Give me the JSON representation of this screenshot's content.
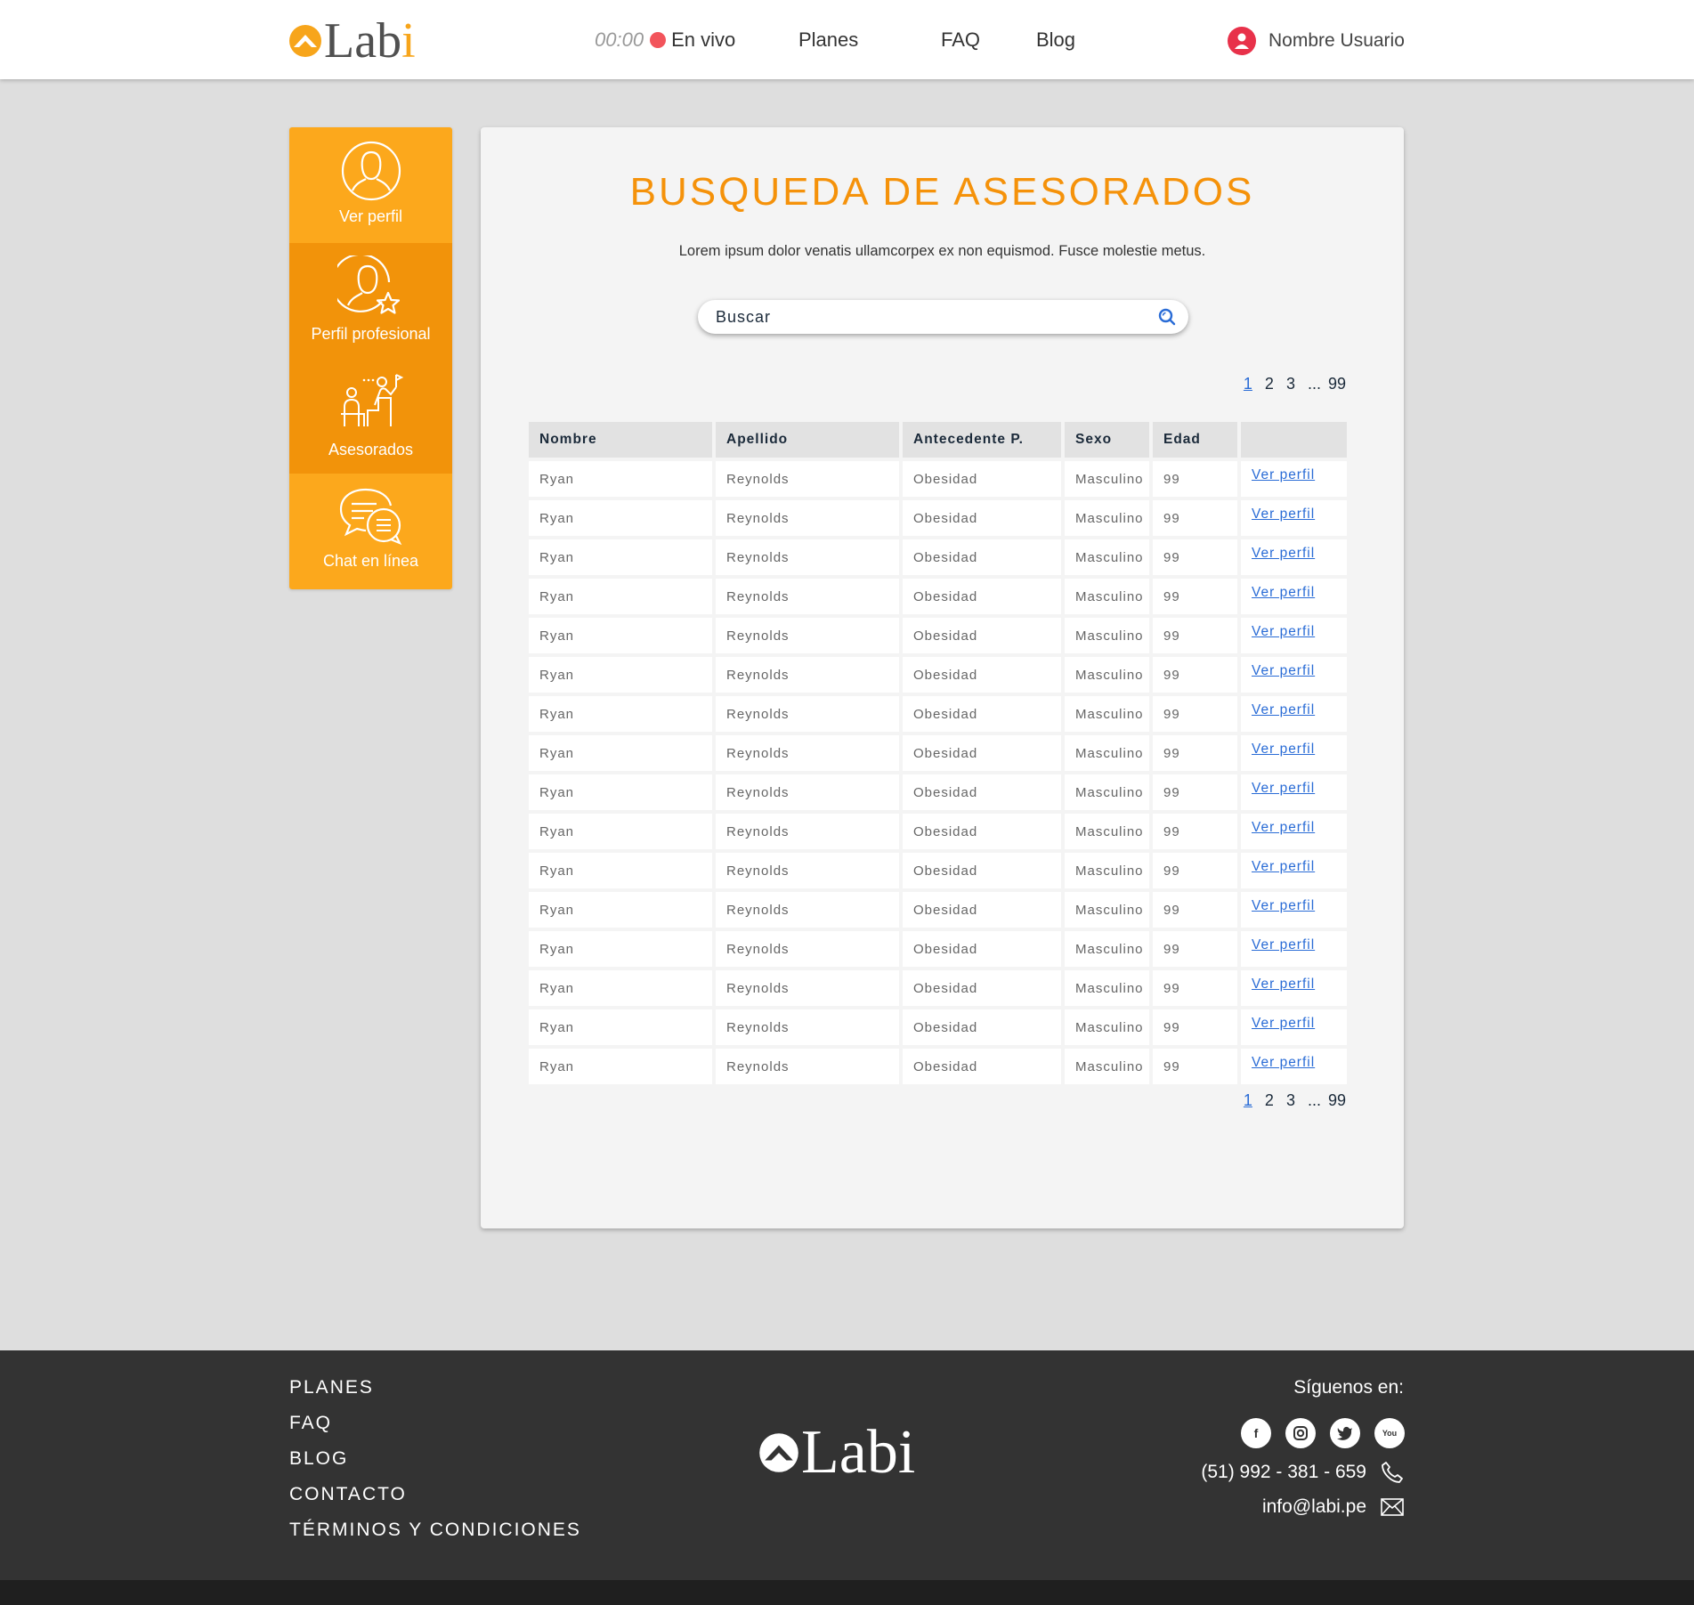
{
  "header": {
    "logo_text": "Labi",
    "timer": "00:00",
    "live_label": "En vivo",
    "nav": [
      "Planes",
      "FAQ",
      "Blog"
    ],
    "user_name": "Nombre Usuario"
  },
  "sidebar": {
    "items": [
      {
        "label": "Ver perfil",
        "icon": "user-icon"
      },
      {
        "label": "Perfil profesional",
        "icon": "user-star-icon"
      },
      {
        "label": "Asesorados",
        "icon": "coaching-icon"
      },
      {
        "label": "Chat en línea",
        "icon": "chat-icon"
      }
    ]
  },
  "main": {
    "title": "BUSQUEDA DE ASESORADOS",
    "subtitle": "Lorem ipsum dolor venatis ullamcorpex ex non equismod. Fusce molestie metus.",
    "search_placeholder": "Buscar",
    "pagination": [
      "1",
      "2",
      "3",
      "...",
      "99"
    ],
    "columns": [
      "Nombre",
      "Apellido",
      "Antecedente P.",
      "Sexo",
      "Edad",
      ""
    ],
    "link_label": "Ver perfil",
    "rows": [
      [
        "Ryan",
        "Reynolds",
        "Obesidad",
        "Masculino",
        "99"
      ],
      [
        "Ryan",
        "Reynolds",
        "Obesidad",
        "Masculino",
        "99"
      ],
      [
        "Ryan",
        "Reynolds",
        "Obesidad",
        "Masculino",
        "99"
      ],
      [
        "Ryan",
        "Reynolds",
        "Obesidad",
        "Masculino",
        "99"
      ],
      [
        "Ryan",
        "Reynolds",
        "Obesidad",
        "Masculino",
        "99"
      ],
      [
        "Ryan",
        "Reynolds",
        "Obesidad",
        "Masculino",
        "99"
      ],
      [
        "Ryan",
        "Reynolds",
        "Obesidad",
        "Masculino",
        "99"
      ],
      [
        "Ryan",
        "Reynolds",
        "Obesidad",
        "Masculino",
        "99"
      ],
      [
        "Ryan",
        "Reynolds",
        "Obesidad",
        "Masculino",
        "99"
      ],
      [
        "Ryan",
        "Reynolds",
        "Obesidad",
        "Masculino",
        "99"
      ],
      [
        "Ryan",
        "Reynolds",
        "Obesidad",
        "Masculino",
        "99"
      ],
      [
        "Ryan",
        "Reynolds",
        "Obesidad",
        "Masculino",
        "99"
      ],
      [
        "Ryan",
        "Reynolds",
        "Obesidad",
        "Masculino",
        "99"
      ],
      [
        "Ryan",
        "Reynolds",
        "Obesidad",
        "Masculino",
        "99"
      ],
      [
        "Ryan",
        "Reynolds",
        "Obesidad",
        "Masculino",
        "99"
      ],
      [
        "Ryan",
        "Reynolds",
        "Obesidad",
        "Masculino",
        "99"
      ]
    ]
  },
  "footer": {
    "links": [
      "PLANES",
      "FAQ",
      "BLOG",
      "CONTACTO",
      "TÉRMINOS Y CONDICIONES"
    ],
    "follow_label": "Síguenos en:",
    "socials": [
      "facebook-icon",
      "instagram-icon",
      "twitter-icon",
      "youtube-icon"
    ],
    "phone": "(51) 992 - 381 - 659",
    "email": "info@labi.pe"
  },
  "colors": {
    "brand_orange": "#f7a51b",
    "sidebar_active": "#f2930a",
    "title_orange": "#f5920a",
    "link_blue": "#2a6cd6",
    "live_red": "#f2545b",
    "footer_bg": "#333333"
  }
}
